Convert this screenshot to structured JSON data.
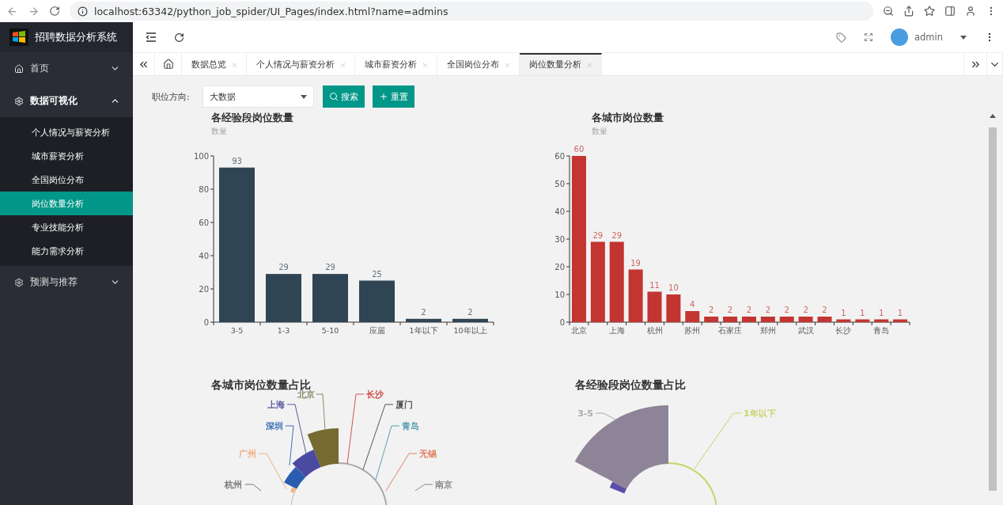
{
  "browser": {
    "url": "localhost:63342/python_job_spider/UI_Pages/index.html?name=admins"
  },
  "sidebar": {
    "title": "招聘数据分析系统",
    "menu": [
      {
        "label": "首页",
        "expanded": false
      },
      {
        "label": "数据可视化",
        "expanded": true,
        "children": [
          {
            "label": "个人情况与薪资分析",
            "selected": false
          },
          {
            "label": "城市薪资分析",
            "selected": false
          },
          {
            "label": "全国岗位分布",
            "selected": false
          },
          {
            "label": "岗位数量分析",
            "selected": true
          },
          {
            "label": "专业技能分析",
            "selected": false
          },
          {
            "label": "能力需求分析",
            "selected": false
          }
        ]
      },
      {
        "label": "预测与推荐",
        "expanded": false
      }
    ]
  },
  "header": {
    "user": "admin"
  },
  "tabs": [
    {
      "label": "数据总览",
      "selected": false
    },
    {
      "label": "个人情况与薪资分析",
      "selected": false
    },
    {
      "label": "城市薪资分析",
      "selected": false
    },
    {
      "label": "全国岗位分布",
      "selected": false
    },
    {
      "label": "岗位数量分析",
      "selected": true
    }
  ],
  "filter": {
    "label": "职位方向:",
    "value": "大数据",
    "buttons": [
      {
        "label": "搜索",
        "kind": "search"
      },
      {
        "label": "重置",
        "kind": "reset"
      }
    ]
  },
  "bar_charts": [
    {
      "chart_data": {
        "type": "bar",
        "title": "各经验段岗位数量",
        "ylabel": "数量",
        "categories": [
          "3-5",
          "1-3",
          "5-10",
          "应届",
          "1年以下",
          "10年以上"
        ],
        "series": [
          {
            "color": "#2f4554",
            "values": [
              93,
              29,
              29,
              25,
              2,
              2
            ]
          }
        ],
        "ylim": [
          0,
          100
        ],
        "yticks": [
          0,
          20,
          40,
          60,
          80,
          100
        ],
        "data_labels": true
      }
    },
    {
      "chart_data": {
        "type": "bar",
        "title": "各城市岗位数量",
        "ylabel": "数量",
        "categories": [
          "北京",
          null,
          "上海",
          null,
          "杭州",
          null,
          "苏州",
          null,
          "石家庄",
          null,
          "郑州",
          null,
          "武汉",
          null,
          "长沙",
          null,
          "青岛",
          null
        ],
        "series": [
          {
            "color": "#c23531",
            "values": [
              60,
              29,
              29,
              19,
              11,
              10,
              4,
              2,
              2,
              2,
              2,
              2,
              2,
              2,
              1,
              1,
              1,
              1
            ]
          }
        ],
        "ylim": [
          0,
          60
        ],
        "yticks": [
          0,
          10,
          20,
          30,
          40,
          50,
          60
        ],
        "data_labels": true
      }
    }
  ],
  "rose_charts": [
    {
      "title": "各城市岗位数量占比",
      "labels": [
        {
          "label": "北京",
          "color": "#8c8a6a"
        },
        {
          "label": "上海",
          "color": "#5a5aa0"
        },
        {
          "label": "深圳",
          "color": "#3f6fb5"
        },
        {
          "label": "广州",
          "color": "#f0b080"
        },
        {
          "label": "杭州",
          "color": "#777777"
        },
        {
          "label": "长沙",
          "color": "#d05050"
        },
        {
          "label": "厦门",
          "color": "#555555"
        },
        {
          "label": "青岛",
          "color": "#5aa0b0"
        },
        {
          "label": "无锡",
          "color": "#e08060"
        },
        {
          "label": "南京",
          "color": "#888888"
        }
      ]
    },
    {
      "title": "各经验段岗位数量占比",
      "labels": [
        {
          "label": "3-5",
          "color": "#aaaaaa"
        },
        {
          "label": "1年以下",
          "color": "#c8d46a"
        }
      ]
    }
  ]
}
